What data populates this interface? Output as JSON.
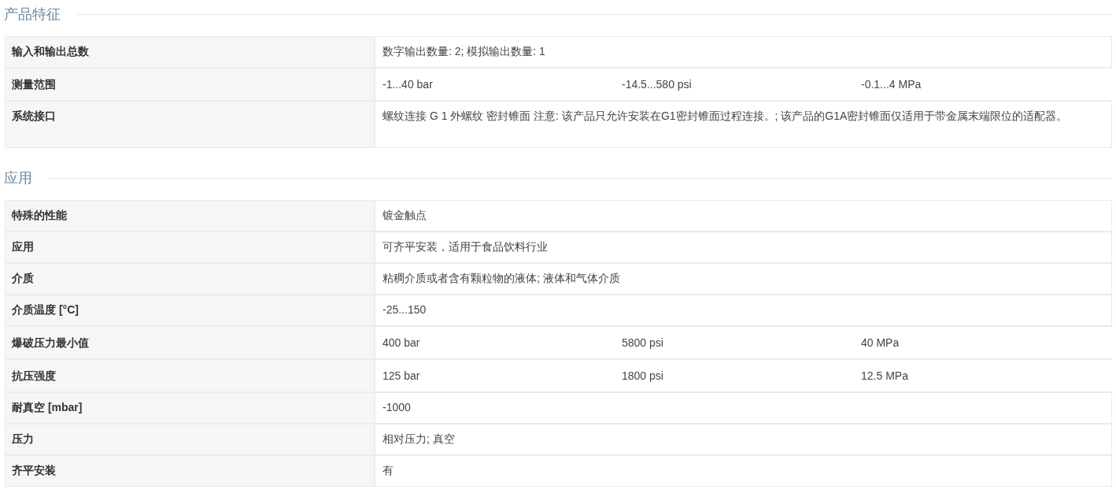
{
  "sections": [
    {
      "title": "产品特征",
      "rows": [
        {
          "label": "输入和输出总数",
          "values": [
            "数字输出数量: 2; 模拟输出数量: 1"
          ]
        },
        {
          "label": "测量范围",
          "values": [
            "-1...40 bar",
            "-14.5...580 psi",
            "-0.1...4 MPa"
          ]
        },
        {
          "label": "系统接口",
          "values": [
            "螺纹连接 G 1 外螺纹 密封锥面 注意: 该产品只允许安装在G1密封锥面过程连接。; 该产品的G1A密封锥面仅适用于带金属末端限位的适配器。"
          ]
        }
      ]
    },
    {
      "title": "应用",
      "rows": [
        {
          "label": "特殊的性能",
          "values": [
            "镀金触点"
          ]
        },
        {
          "label": "应用",
          "values": [
            "可齐平安装，适用于食品饮料行业"
          ]
        },
        {
          "label": "介质",
          "values": [
            "粘稠介质或者含有颗粒物的液体; 液体和气体介质"
          ]
        },
        {
          "label": "介质温度 [°C]",
          "values": [
            "-25...150"
          ]
        },
        {
          "label": "爆破压力最小值",
          "values": [
            "400 bar",
            "5800 psi",
            "40 MPa"
          ]
        },
        {
          "label": "抗压强度",
          "values": [
            "125 bar",
            "1800 psi",
            "12.5 MPa"
          ]
        },
        {
          "label": "耐真空 [mbar]",
          "values": [
            "-1000"
          ]
        },
        {
          "label": "压力",
          "values": [
            "相对压力; 真空"
          ]
        },
        {
          "label": "齐平安装",
          "values": [
            "有"
          ]
        }
      ]
    }
  ]
}
